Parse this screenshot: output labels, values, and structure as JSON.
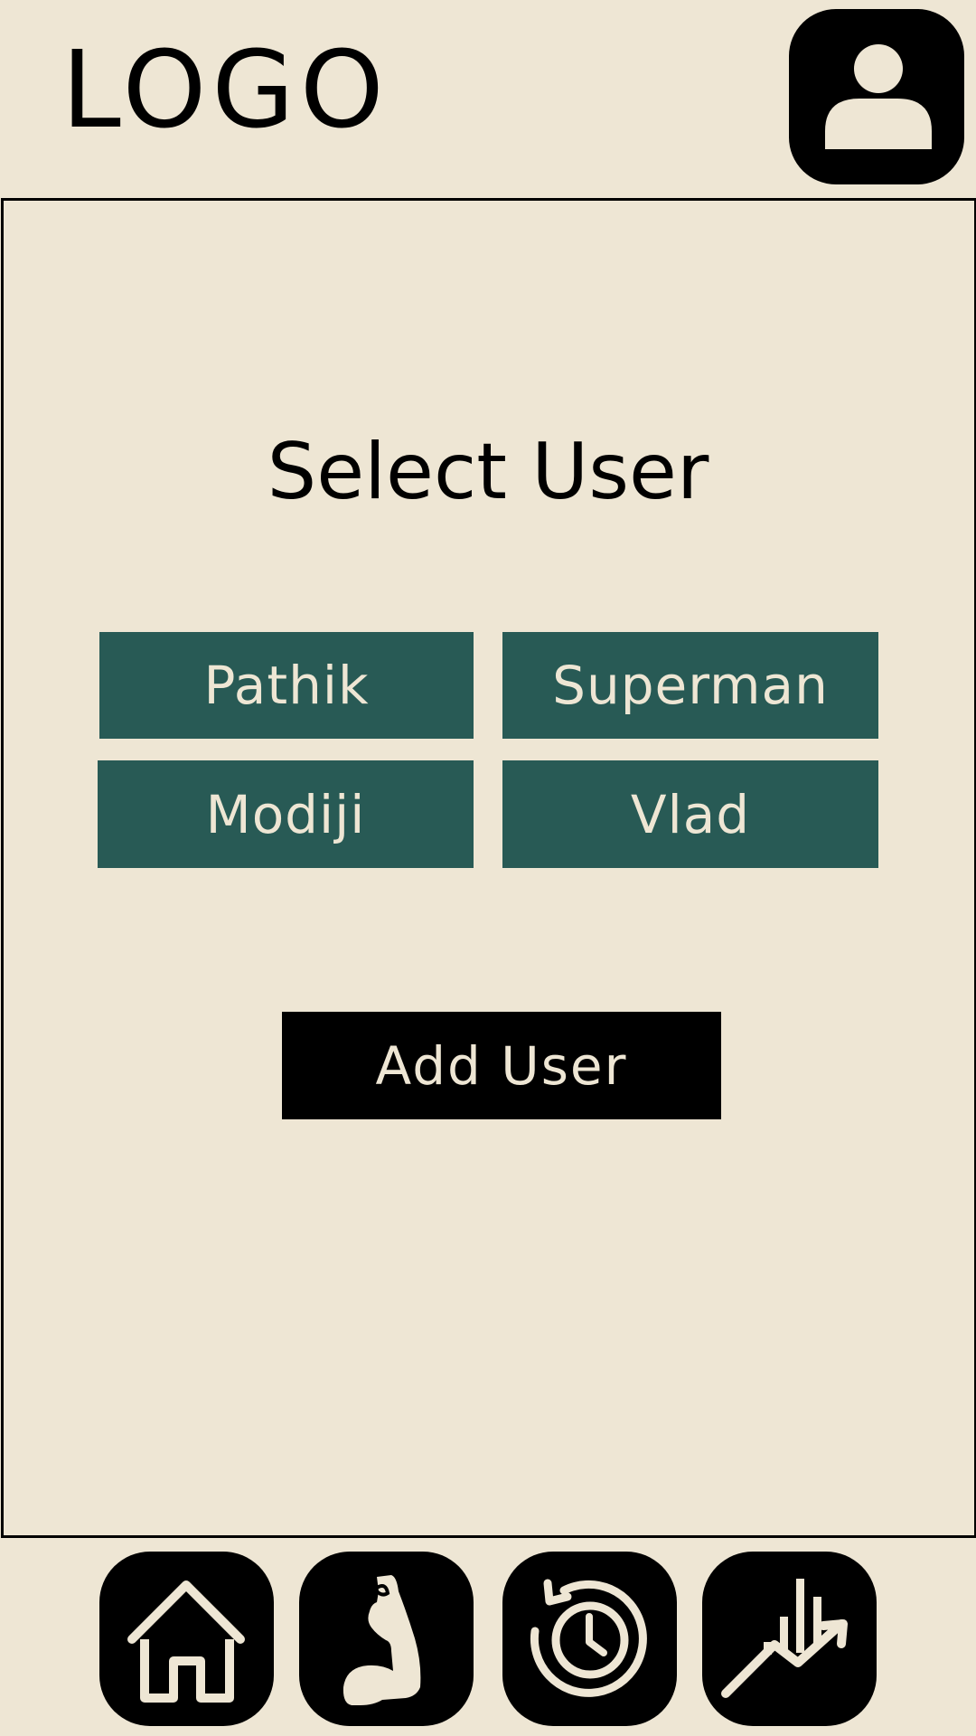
{
  "header": {
    "logo_text": "LOGO",
    "profile_icon": "user-profile-icon"
  },
  "main": {
    "title": "Select User",
    "users": [
      {
        "label": "Pathik"
      },
      {
        "label": "Superman"
      },
      {
        "label": "Modiji"
      },
      {
        "label": "Vlad"
      }
    ],
    "add_user_label": "Add User"
  },
  "nav": {
    "items": [
      {
        "icon": "home-icon"
      },
      {
        "icon": "flexed-arm-icon"
      },
      {
        "icon": "history-clock-icon"
      },
      {
        "icon": "stats-chart-icon"
      }
    ]
  },
  "colors": {
    "background": "#EEE6D4",
    "user_button": "#285A55",
    "dark": "#000000",
    "light_text": "#EEE6D4"
  }
}
